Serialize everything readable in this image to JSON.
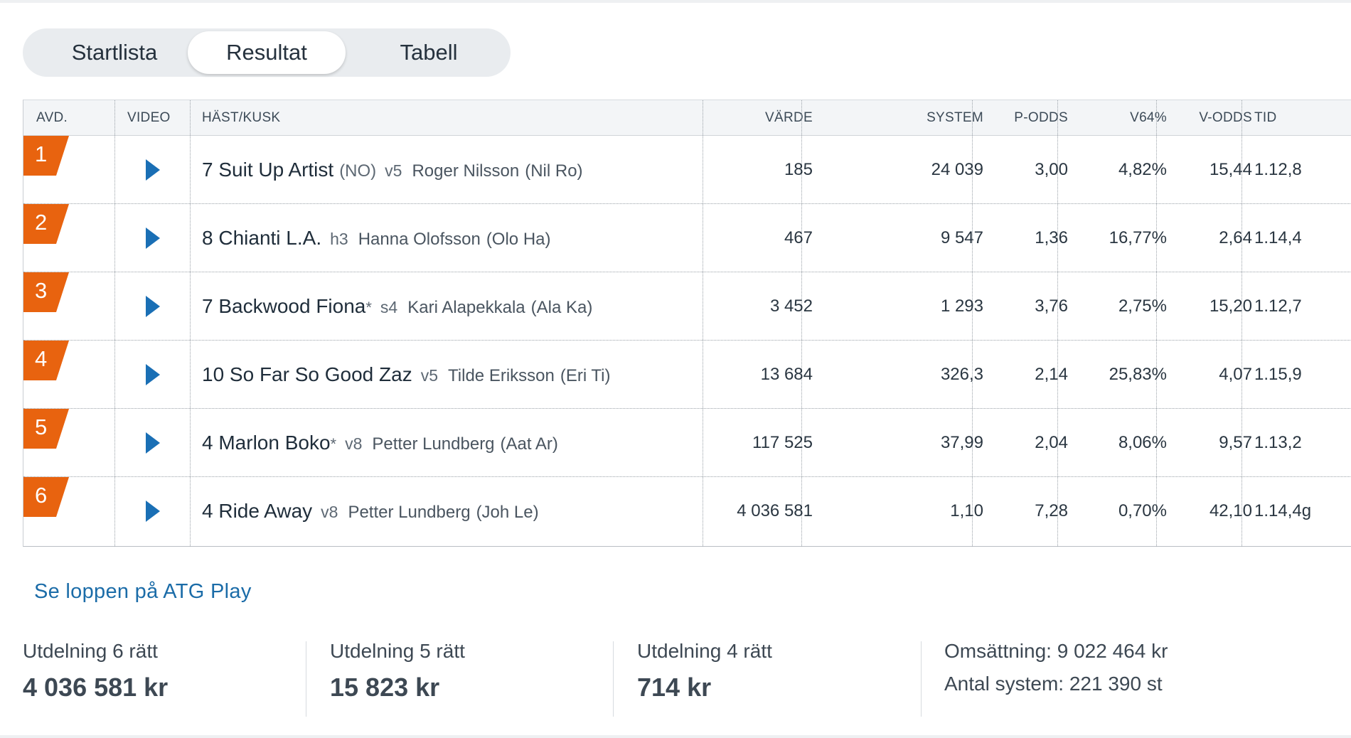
{
  "tabs": [
    "Startlista",
    "Resultat",
    "Tabell"
  ],
  "active_tab": "Resultat",
  "table": {
    "headers": {
      "avd": "AVD.",
      "video": "VIDEO",
      "hast": "HÄST/KUSK",
      "varde": "VÄRDE",
      "system": "SYSTEM",
      "podds": "P-ODDS",
      "v64": "V64%",
      "vodds": "V-ODDS",
      "tid": "TID"
    },
    "rows": [
      {
        "avd": "1",
        "horse": "7 Suit Up Artist",
        "flag": "(NO)",
        "star": "",
        "code": "v5",
        "driver": "Roger Nilsson",
        "short": "(Nil Ro)",
        "varde": "185",
        "system": "24 039",
        "podds": "3,00",
        "v64": "4,82%",
        "vodds": "15,44",
        "tid": "1.12,8"
      },
      {
        "avd": "2",
        "horse": "8 Chianti L.A.",
        "flag": "",
        "star": "",
        "code": "h3",
        "driver": "Hanna Olofsson",
        "short": "(Olo Ha)",
        "varde": "467",
        "system": "9 547",
        "podds": "1,36",
        "v64": "16,77%",
        "vodds": "2,64",
        "tid": "1.14,4"
      },
      {
        "avd": "3",
        "horse": "7 Backwood Fiona",
        "flag": "",
        "star": "*",
        "code": "s4",
        "driver": "Kari Alapekkala",
        "short": "(Ala Ka)",
        "varde": "3 452",
        "system": "1 293",
        "podds": "3,76",
        "v64": "2,75%",
        "vodds": "15,20",
        "tid": "1.12,7"
      },
      {
        "avd": "4",
        "horse": "10 So Far So Good Zaz",
        "flag": "",
        "star": "",
        "code": "v5",
        "driver": "Tilde Eriksson",
        "short": "(Eri Ti)",
        "varde": "13 684",
        "system": "326,3",
        "podds": "2,14",
        "v64": "25,83%",
        "vodds": "4,07",
        "tid": "1.15,9"
      },
      {
        "avd": "5",
        "horse": "4 Marlon Boko",
        "flag": "",
        "star": "*",
        "code": "v8",
        "driver": "Petter Lundberg",
        "short": "(Aat Ar)",
        "varde": "117 525",
        "system": "37,99",
        "podds": "2,04",
        "v64": "8,06%",
        "vodds": "9,57",
        "tid": "1.13,2"
      },
      {
        "avd": "6",
        "horse": "4 Ride Away",
        "flag": "",
        "star": "",
        "code": "v8",
        "driver": "Petter Lundberg",
        "short": "(Joh Le)",
        "varde": "4 036 581",
        "system": "1,10",
        "podds": "7,28",
        "v64": "0,70%",
        "vodds": "42,10",
        "tid": "1.14,4g"
      }
    ]
  },
  "link": "Se loppen på ATG Play",
  "payouts": [
    {
      "label": "Utdelning 6 rätt",
      "value": "4 036 581 kr"
    },
    {
      "label": "Utdelning 5 rätt",
      "value": "15 823 kr"
    },
    {
      "label": "Utdelning 4 rätt",
      "value": "714 kr"
    }
  ],
  "totals": {
    "omsattning": "Omsättning: 9 022 464 kr",
    "antal_system": "Antal system: 221 390 st"
  },
  "colors": {
    "badge": "#e8630f",
    "play": "#1a6fb5",
    "link": "#1b6ca8"
  },
  "icons": {
    "play": "play-icon",
    "badge": "avd-flag-icon"
  }
}
